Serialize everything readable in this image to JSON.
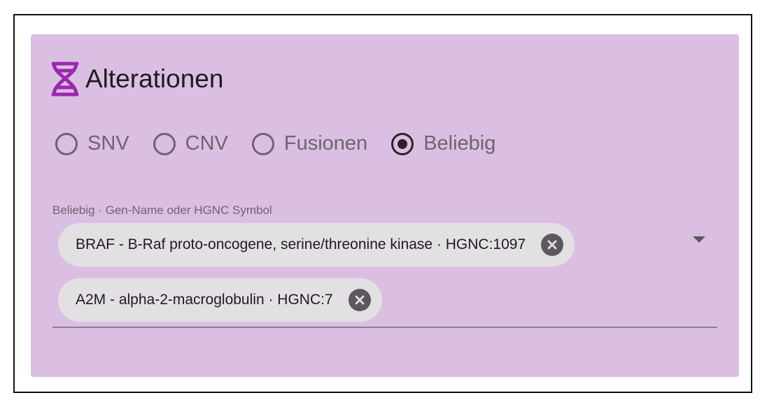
{
  "section": {
    "title": "Alterationen",
    "icon": "dna-icon",
    "accent_color": "#9c27b0",
    "background_color": "#dabfe3"
  },
  "radio_group": {
    "options": [
      {
        "label": "SNV",
        "checked": false
      },
      {
        "label": "CNV",
        "checked": false
      },
      {
        "label": "Fusionen",
        "checked": false
      },
      {
        "label": "Beliebig",
        "checked": true
      }
    ]
  },
  "gene_field": {
    "label": "Beliebig · Gen-Name oder HGNC Symbol",
    "chips": [
      {
        "label": "BRAF - B-Raf proto-oncogene, serine/threonine kinase · HGNC:1097",
        "remove_icon": "cancel-icon"
      },
      {
        "label": "A2M - alpha-2-macroglobulin · HGNC:7",
        "remove_icon": "cancel-icon"
      }
    ],
    "dropdown_icon": "arrow-drop-down-icon"
  }
}
